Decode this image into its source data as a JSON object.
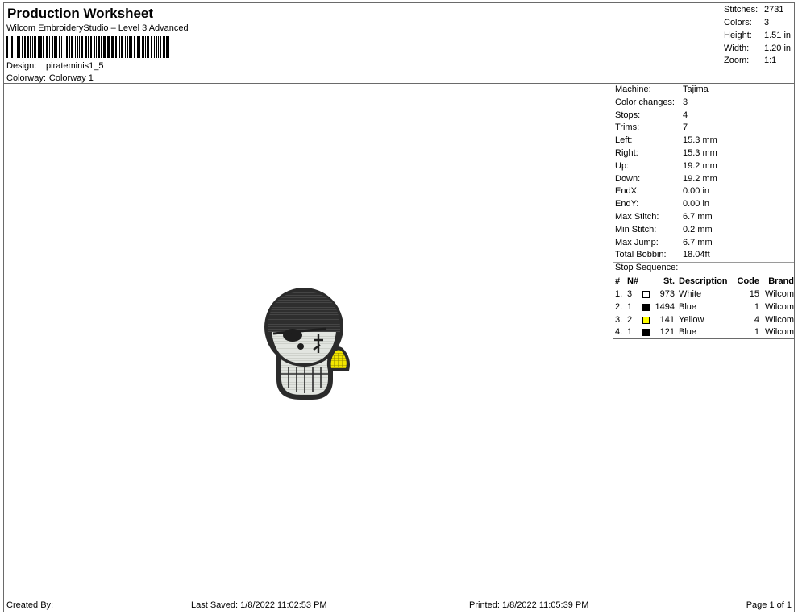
{
  "header": {
    "title": "Production Worksheet",
    "subtitle": "Wilcom EmbroideryStudio – Level 3 Advanced",
    "design_label": "Design:",
    "design_value": "pirateminis1_5",
    "colorway_label": "Colorway:",
    "colorway_value": "Colorway 1"
  },
  "summary": [
    {
      "label": "Stitches:",
      "value": "2731"
    },
    {
      "label": "Colors:",
      "value": "3"
    },
    {
      "label": "Height:",
      "value": "1.51 in"
    },
    {
      "label": "Width:",
      "value": "1.20 in"
    },
    {
      "label": "Zoom:",
      "value": "1:1"
    }
  ],
  "info": [
    {
      "label": "Machine:",
      "value": "Tajima"
    },
    {
      "label": "Color changes:",
      "value": "3"
    },
    {
      "label": "Stops:",
      "value": "4"
    },
    {
      "label": "Trims:",
      "value": "7"
    },
    {
      "label": "Left:",
      "value": "15.3 mm"
    },
    {
      "label": "Right:",
      "value": "15.3 mm"
    },
    {
      "label": "Up:",
      "value": "19.2 mm"
    },
    {
      "label": "Down:",
      "value": "19.2 mm"
    },
    {
      "label": "EndX:",
      "value": "0.00 in"
    },
    {
      "label": "EndY:",
      "value": "0.00 in"
    },
    {
      "label": "Max Stitch:",
      "value": "6.7 mm"
    },
    {
      "label": "Min Stitch:",
      "value": "0.2 mm"
    },
    {
      "label": "Max Jump:",
      "value": "6.7 mm"
    },
    {
      "label": "Total Bobbin:",
      "value": "18.04ft"
    }
  ],
  "stop_sequence": {
    "label": "Stop Sequence:",
    "headers": {
      "idx": "#",
      "n": "N#",
      "st": "St.",
      "desc": "Description",
      "code": "Code",
      "brand": "Brand"
    },
    "rows": [
      {
        "idx": "1.",
        "n": "3",
        "color": "#ffffff",
        "st": "973",
        "desc": "White",
        "code": "15",
        "brand": "Wilcom"
      },
      {
        "idx": "2.",
        "n": "1",
        "color": "#000000",
        "st": "1494",
        "desc": "Blue",
        "code": "1",
        "brand": "Wilcom"
      },
      {
        "idx": "3.",
        "n": "2",
        "color": "#ffff00",
        "st": "141",
        "desc": "Yellow",
        "code": "4",
        "brand": "Wilcom"
      },
      {
        "idx": "4.",
        "n": "1",
        "color": "#000000",
        "st": "121",
        "desc": "Blue",
        "code": "1",
        "brand": "Wilcom"
      }
    ]
  },
  "footer": {
    "created_by": "Created By:",
    "last_saved": "Last Saved: 1/8/2022 11:02:53 PM",
    "printed": "Printed: 1/8/2022 11:05:39 PM",
    "page": "Page 1 of 1"
  },
  "colors": {
    "thread_dark": "#2b2b2b",
    "thread_light": "#e6e8e4",
    "thread_yellow": "#f2e600",
    "frame": "#6a6a6a"
  }
}
